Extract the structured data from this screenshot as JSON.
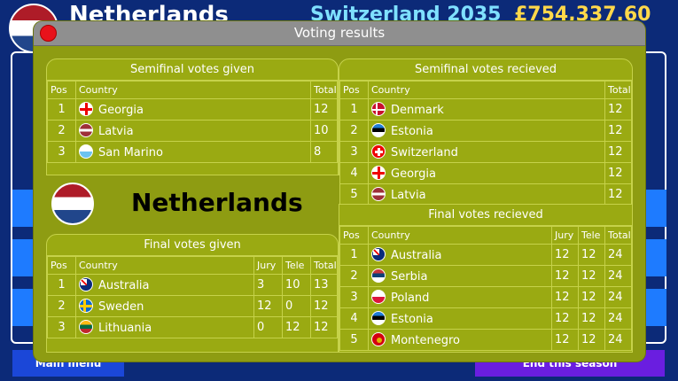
{
  "background": {
    "country_title": "Netherlands",
    "country_year": "Switzerland 2035",
    "money": "£754,337.60",
    "left_button": "Main menu",
    "right_button": "End this season"
  },
  "dialog": {
    "title": "Voting results",
    "country_name": "Netherlands",
    "columns": {
      "pos": "Pos",
      "country": "Country",
      "total": "Total",
      "jury": "Jury",
      "tele": "Tele"
    },
    "semi_given": {
      "heading": "Semifinal votes given",
      "rows": [
        {
          "pos": "1",
          "country": "Georgia",
          "flag": "georgia-flag-icon",
          "total": "12"
        },
        {
          "pos": "2",
          "country": "Latvia",
          "flag": "latvia-flag-icon",
          "total": "10"
        },
        {
          "pos": "3",
          "country": "San Marino",
          "flag": "san-marino-flag-icon",
          "total": "8"
        }
      ]
    },
    "semi_received": {
      "heading": "Semifinal votes recieved",
      "rows": [
        {
          "pos": "1",
          "country": "Denmark",
          "flag": "denmark-flag-icon",
          "total": "12"
        },
        {
          "pos": "2",
          "country": "Estonia",
          "flag": "estonia-flag-icon",
          "total": "12"
        },
        {
          "pos": "3",
          "country": "Switzerland",
          "flag": "switzerland-flag-icon",
          "total": "12"
        },
        {
          "pos": "4",
          "country": "Georgia",
          "flag": "georgia-flag-icon",
          "total": "12"
        },
        {
          "pos": "5",
          "country": "Latvia",
          "flag": "latvia-flag-icon",
          "total": "12"
        }
      ]
    },
    "final_given": {
      "heading": "Final votes given",
      "rows": [
        {
          "pos": "1",
          "country": "Australia",
          "flag": "australia-flag-icon",
          "jury": "3",
          "tele": "10",
          "total": "13"
        },
        {
          "pos": "2",
          "country": "Sweden",
          "flag": "sweden-flag-icon",
          "jury": "12",
          "tele": "0",
          "total": "12"
        },
        {
          "pos": "3",
          "country": "Lithuania",
          "flag": "lithuania-flag-icon",
          "jury": "0",
          "tele": "12",
          "total": "12"
        }
      ]
    },
    "final_received": {
      "heading": "Final votes recieved",
      "rows": [
        {
          "pos": "1",
          "country": "Australia",
          "flag": "australia-flag-icon",
          "jury": "12",
          "tele": "12",
          "total": "24"
        },
        {
          "pos": "2",
          "country": "Serbia",
          "flag": "serbia-flag-icon",
          "jury": "12",
          "tele": "12",
          "total": "24"
        },
        {
          "pos": "3",
          "country": "Poland",
          "flag": "poland-flag-icon",
          "jury": "12",
          "tele": "12",
          "total": "24"
        },
        {
          "pos": "4",
          "country": "Estonia",
          "flag": "estonia-flag-icon",
          "jury": "12",
          "tele": "12",
          "total": "24"
        },
        {
          "pos": "5",
          "country": "Montenegro",
          "flag": "montenegro-flag-icon",
          "jury": "12",
          "tele": "12",
          "total": "24"
        }
      ]
    }
  }
}
